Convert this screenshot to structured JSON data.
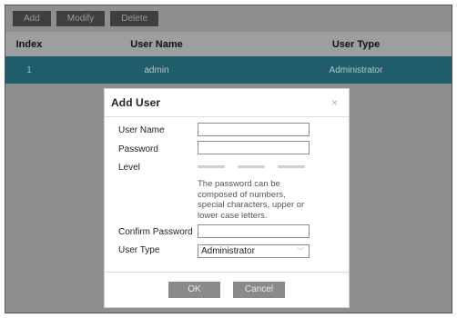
{
  "toolbar": {
    "add_label": "Add",
    "modify_label": "Modify",
    "delete_label": "Delete"
  },
  "table": {
    "columns": [
      "Index",
      "User Name",
      "User Type"
    ],
    "rows": [
      {
        "index": "1",
        "user_name": "admin",
        "user_type": "Administrator"
      }
    ]
  },
  "dialog": {
    "title": "Add User",
    "close_glyph": "×",
    "labels": {
      "user_name": "User Name",
      "password": "Password",
      "level": "Level",
      "confirm_password": "Confirm Password",
      "user_type": "User Type"
    },
    "fields": {
      "user_name_value": "",
      "password_value": "",
      "confirm_password_value": ""
    },
    "password_hint": "The password can be composed of numbers, special characters, upper or lower case letters.",
    "user_type_selected": "Administrator",
    "ok_label": "OK",
    "cancel_label": "Cancel"
  }
}
